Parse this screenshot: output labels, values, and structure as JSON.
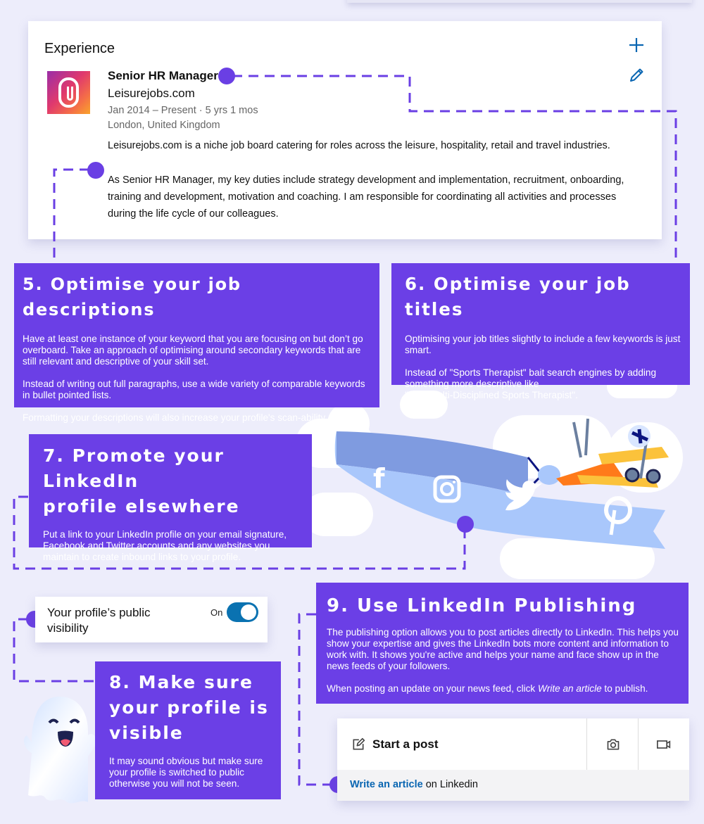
{
  "experience": {
    "section_title": "Experience",
    "add_icon": "plus-icon",
    "edit_icon": "pencil-icon",
    "job_title": "Senior HR Manager",
    "company": "Leisurejobs.com",
    "dates": "Jan 2014 – Present · 5 yrs 1 mos",
    "location": "London, United Kingdom",
    "summary": "Leisurejobs.com is a niche job board catering for roles across the leisure, hospitality, retail and travel industries.",
    "duties": " As Senior HR Manager, my key duties include strategy development and implementation, recruitment, onboarding, training and development, motivation and coaching. I am responsible for coordinating all activities and processes during the life cycle of our colleagues."
  },
  "tips": [
    {
      "title": "5. Optimise your job descriptions",
      "paragraphs": [
        "Have at least one instance of your keyword that you are focusing on but don’t go overboard. Take an approach of optimising around secondary keywords that are still relevant and descriptive of your skill set.",
        "Instead of writing out full paragraphs, use a wide variety of comparable keywords in bullet pointed lists.",
        "Formatting your descriptions will also increase your profile's scan-ability."
      ]
    },
    {
      "title": "6. Optimise your job titles",
      "paragraphs": [
        "Optimising your job titles slightly to include a few keywords is just smart.",
        "Instead of \"Sports Therapist\" bait search engines by adding something more descriptive like",
        "\"Elite Multi-Disciplined Sports Therapist\"."
      ]
    },
    {
      "title_line1": "7. Promote your LinkedIn",
      "title_line2": "profile elsewhere",
      "paragraphs": [
        "Put a link to your LinkedIn profile on your email signature, Facebook and Twitter accounts and any websites you maintain to create inbound links to your profile."
      ]
    },
    {
      "title_line1": "8. Make sure",
      "title_line2": "your profile is",
      "title_line3": "visible",
      "paragraphs": [
        "It may sound obvious but make sure your profile is switched to public otherwise you will not be seen."
      ]
    },
    {
      "title": "9. Use LinkedIn Publishing",
      "paragraphs": [
        "The publishing option allows you to post articles directly to LinkedIn. This helps you show your expertise and gives the LinkedIn bots more content and information to work with. It shows you're active and helps your name and face show up in the news feeds of your followers."
      ],
      "cta_prefix": "When posting an update on your news feed, click ",
      "cta_italic": "Write an article",
      "cta_suffix": " to publish."
    }
  ],
  "banner": {
    "icons": [
      "facebook-icon",
      "instagram-icon",
      "twitter-icon",
      "pinterest-icon"
    ]
  },
  "visibility": {
    "label": "Your profile’s public visibility",
    "state_label": "On",
    "enabled": true
  },
  "post_box": {
    "start_label": "Start a post",
    "camera_icon": "camera-icon",
    "video_icon": "video-icon",
    "write_link": "Write an article",
    "write_suffix": " on Linkedin"
  },
  "colors": {
    "accent": "#6b3fe6",
    "background": "#ededfb",
    "linkedin_blue": "#0a66b2"
  }
}
